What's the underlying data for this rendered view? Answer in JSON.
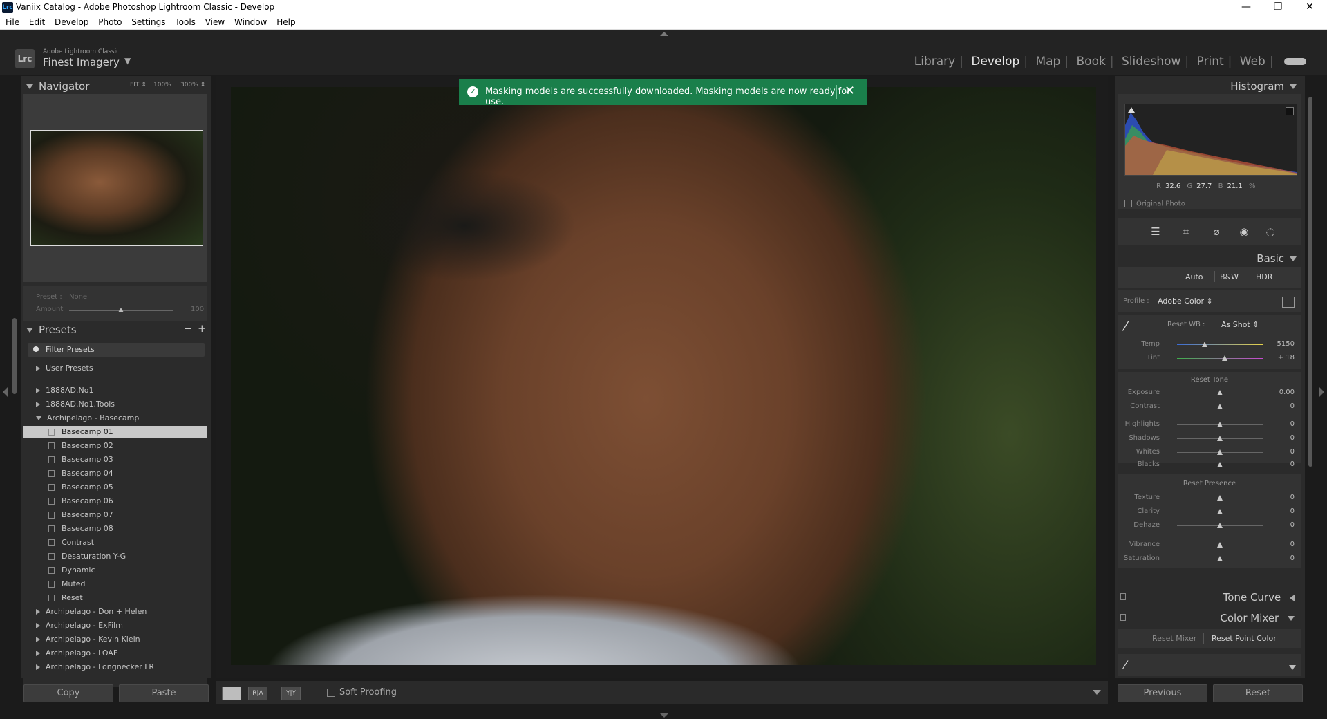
{
  "window": {
    "title": "Vaniix Catalog - Adobe Photoshop Lightroom Classic - Develop",
    "app_icon": "Lrc",
    "minimize": "—",
    "maximize": "❐",
    "close": "✕"
  },
  "menu": [
    "File",
    "Edit",
    "Develop",
    "Photo",
    "Settings",
    "Tools",
    "View",
    "Window",
    "Help"
  ],
  "brand": {
    "badge": "Lrc",
    "small": "Adobe Lightroom Classic",
    "name": "Finest Imagery",
    "caret": "▼"
  },
  "modules": [
    "Library",
    "Develop",
    "Map",
    "Book",
    "Slideshow",
    "Print",
    "Web"
  ],
  "active_module": "Develop",
  "navigator": {
    "title": "Navigator",
    "zoom": [
      "FIT ⇕",
      "100%",
      "300% ⇕"
    ]
  },
  "preset_amount": {
    "preset_label": "Preset :",
    "preset_value": "None",
    "amount_label": "Amount",
    "amount_value": "100"
  },
  "presets": {
    "title": "Presets",
    "minus": "−",
    "plus": "+",
    "filter": "Filter Presets",
    "user": "User Presets",
    "groups": [
      "1888AD.No1",
      "1888AD.No1.Tools",
      "Archipelago - Basecamp"
    ],
    "items": [
      "Basecamp 01",
      "Basecamp 02",
      "Basecamp 03",
      "Basecamp 04",
      "Basecamp 05",
      "Basecamp 06",
      "Basecamp 07",
      "Basecamp 08",
      "Contrast",
      "Desaturation Y-G",
      "Dynamic",
      "Muted",
      "Reset"
    ],
    "more_groups": [
      "Archipelago - Don + Helen",
      "Archipelago - ExFilm",
      "Archipelago - Kevin Klein",
      "Archipelago - LOAF",
      "Archipelago - Longnecker LR"
    ]
  },
  "left_buttons": {
    "copy": "Copy",
    "paste": "Paste"
  },
  "toast": {
    "message": "Masking models are successfully downloaded. Masking models are now ready for use.",
    "check": "✓",
    "close": "✕"
  },
  "filmbar": {
    "soft_proofing": "Soft Proofing",
    "compare": "R|A",
    "survey": "Y|Y"
  },
  "histogram": {
    "title": "Histogram",
    "r_label": "R",
    "r": "32.6",
    "g_label": "G",
    "g": "27.7",
    "b_label": "B",
    "b": "21.1",
    "unit": "%",
    "original_photo": "Original Photo"
  },
  "basic": {
    "title": "Basic",
    "auto": "Auto",
    "bw": "B&W",
    "hdr": "HDR",
    "profile_label": "Profile :",
    "profile_value": "Adobe Color ⇕",
    "reset_wb": "Reset WB :",
    "wb_value": "As Shot ⇕",
    "wb_rows": [
      {
        "label": "Temp",
        "value": "5150",
        "pos": 0.3
      },
      {
        "label": "Tint",
        "value": "+ 18",
        "pos": 0.56
      }
    ],
    "reset_tone": "Reset Tone",
    "tone_rows": [
      {
        "label": "Exposure",
        "value": "0.00"
      },
      {
        "label": "Contrast",
        "value": "0"
      },
      {
        "label": "Highlights",
        "value": "0"
      },
      {
        "label": "Shadows",
        "value": "0"
      },
      {
        "label": "Whites",
        "value": "0"
      },
      {
        "label": "Blacks",
        "value": "0"
      }
    ],
    "reset_presence": "Reset Presence",
    "presence_rows": [
      {
        "label": "Texture",
        "value": "0"
      },
      {
        "label": "Clarity",
        "value": "0"
      },
      {
        "label": "Dehaze",
        "value": "0"
      },
      {
        "label": "Vibrance",
        "value": "0"
      },
      {
        "label": "Saturation",
        "value": "0"
      }
    ]
  },
  "tone_curve": {
    "title": "Tone Curve"
  },
  "color_mixer": {
    "title": "Color Mixer",
    "reset_mixer": "Reset Mixer",
    "reset_point": "Reset Point Color"
  },
  "right_buttons": {
    "previous": "Previous",
    "reset": "Reset"
  },
  "colors": {
    "toast": "#1a7f4b",
    "panel": "#2b2b2b",
    "active_preset": "#c8c8c8"
  }
}
